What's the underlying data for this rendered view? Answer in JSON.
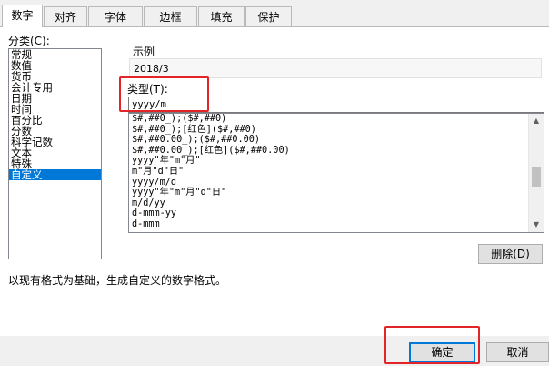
{
  "tabs": [
    "数字",
    "对齐",
    "字体",
    "边框",
    "填充",
    "保护"
  ],
  "category": {
    "label": "分类(C):",
    "items": [
      "常规",
      "数值",
      "货币",
      "会计专用",
      "日期",
      "时间",
      "百分比",
      "分数",
      "科学记数",
      "文本",
      "特殊",
      "自定义"
    ],
    "selected": "自定义"
  },
  "sample": {
    "label": "示例",
    "value": "2018/3"
  },
  "type_field": {
    "label": "类型(T):",
    "value": "yyyy/m"
  },
  "format_list": [
    "$#,##0_);($#,##0)",
    "$#,##0_);[红色]($#,##0)",
    "$#,##0.00_);($#,##0.00)",
    "$#,##0.00_);[红色]($#,##0.00)",
    "yyyy\"年\"m\"月\"",
    "m\"月\"d\"日\"",
    "yyyy/m/d",
    "yyyy\"年\"m\"月\"d\"日\"",
    "m/d/yy",
    "d-mmm-yy",
    "d-mmm"
  ],
  "delete_button": "删除(D)",
  "description": "以现有格式为基础，生成自定义的数字格式。",
  "ok_button": "确定",
  "cancel_button": "取消",
  "colors": {
    "selection": "#0078d7",
    "highlight_box": "#e3252a"
  }
}
